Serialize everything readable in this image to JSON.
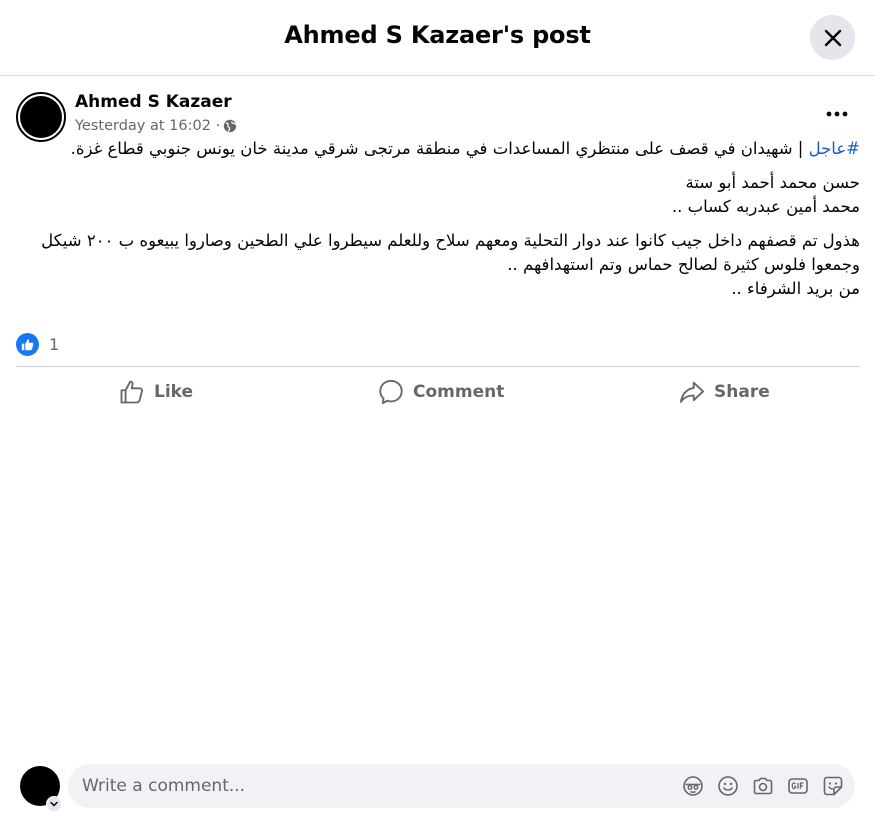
{
  "header": {
    "title": "Ahmed S Kazaer's post"
  },
  "post": {
    "author": "Ahmed S Kazaer",
    "timestamp": "Yesterday at 16:02 ·",
    "privacy_icon": "globe-icon",
    "hashtag": "#عاجل",
    "paragraph1_rest": " | شهيدان في قصف على منتظري المساعدات في منطقة مرتجى شرقي مدينة خان يونس جنوبي قطاع غزة.",
    "paragraph2_line1": "حسن محمد أحمد أبو ستة",
    "paragraph2_line2": "محمد أمين عبدربه كساب ..",
    "paragraph3_line1": "هذول تم قصفهم داخل جيب كانوا عند دوار التحلية ومعهم سلاح وللعلم سيطروا علي الطحين وصاروا يبيعوه ب ٢٠٠ شيكل وجمعوا فلوس كثيرة لصالح حماس وتم استهدافهم ..",
    "paragraph3_line2": "من بريد الشرفاء .."
  },
  "reactions": {
    "icon": "like-icon",
    "count": "1"
  },
  "actions": {
    "like": "Like",
    "comment": "Comment",
    "share": "Share"
  },
  "comment_composer": {
    "placeholder": "Write a comment...",
    "icons": [
      "avatar-sticker-icon",
      "emoji-icon",
      "camera-icon",
      "gif-icon",
      "sticker-icon"
    ]
  },
  "colors": {
    "accent": "#1877f2",
    "hashtag": "#1a5dc2",
    "secondary_text": "#65676b",
    "input_bg": "#f0f2f5",
    "button_bg": "#e4e6eb"
  }
}
